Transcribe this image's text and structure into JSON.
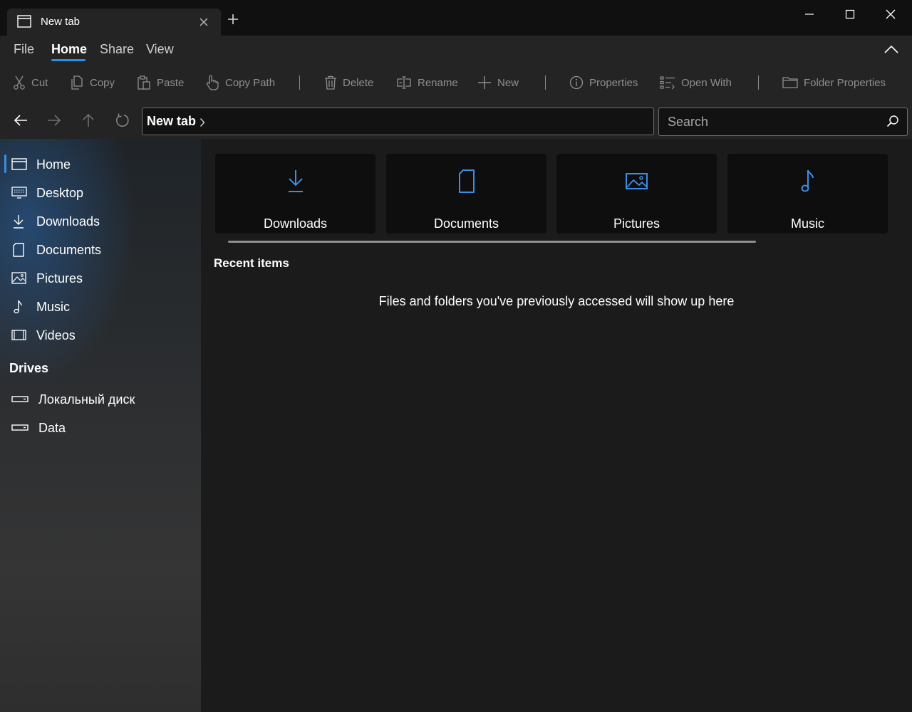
{
  "window": {
    "tab_title": "New tab",
    "controls": [
      "minimize-icon",
      "maximize-icon",
      "close-icon"
    ]
  },
  "ribbon": {
    "menu": [
      {
        "label": "File",
        "active": false
      },
      {
        "label": "Home",
        "active": true
      },
      {
        "label": "Share",
        "active": false
      },
      {
        "label": "View",
        "active": false
      }
    ],
    "tools": [
      {
        "label": "Cut",
        "icon": "cut-icon"
      },
      {
        "label": "Copy",
        "icon": "copy-icon"
      },
      {
        "label": "Paste",
        "icon": "paste-icon"
      },
      {
        "label": "Copy Path",
        "icon": "copy-path-icon"
      },
      {
        "label": "Delete",
        "icon": "delete-icon"
      },
      {
        "label": "Rename",
        "icon": "rename-icon"
      },
      {
        "label": "New",
        "icon": "new-icon"
      },
      {
        "label": "Properties",
        "icon": "info-icon"
      },
      {
        "label": "Open With",
        "icon": "open-with-icon"
      },
      {
        "label": "Folder Properties",
        "icon": "folder-icon"
      }
    ]
  },
  "nav": {
    "breadcrumb": "New tab",
    "search_placeholder": "Search"
  },
  "sidebar": {
    "items": [
      {
        "label": "Home",
        "icon": "home-icon",
        "selected": true
      },
      {
        "label": "Desktop",
        "icon": "desktop-icon"
      },
      {
        "label": "Downloads",
        "icon": "download-icon"
      },
      {
        "label": "Documents",
        "icon": "document-icon"
      },
      {
        "label": "Pictures",
        "icon": "picture-icon"
      },
      {
        "label": "Music",
        "icon": "music-icon"
      },
      {
        "label": "Videos",
        "icon": "video-icon"
      }
    ],
    "drives_header": "Drives",
    "drives": [
      {
        "label": "Локальный диск",
        "icon": "drive-icon"
      },
      {
        "label": "Data",
        "icon": "drive-icon"
      }
    ]
  },
  "main": {
    "cards": [
      {
        "label": "Downloads",
        "icon": "download-icon"
      },
      {
        "label": "Documents",
        "icon": "document-icon"
      },
      {
        "label": "Pictures",
        "icon": "picture-icon"
      },
      {
        "label": "Music",
        "icon": "music-icon"
      }
    ],
    "recent_title": "Recent items",
    "recent_empty": "Files and folders you've previously accessed will show up here"
  },
  "colors": {
    "accent": "#3a8ee6",
    "background": "#1b1b1b",
    "ribbon": "#242424",
    "titlebar": "#101010",
    "card": "#0e0e0e"
  }
}
